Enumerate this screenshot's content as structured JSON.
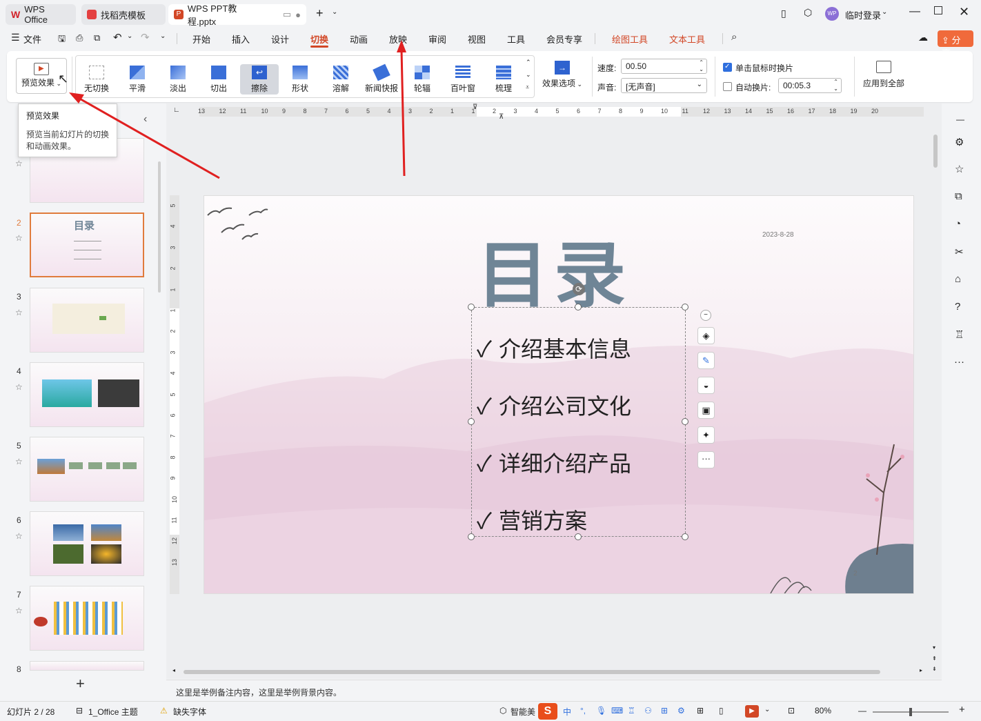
{
  "tabs": [
    {
      "label": "WPS Office"
    },
    {
      "label": "找稻壳模板"
    },
    {
      "label": "WPS PPT教程.pptx"
    }
  ],
  "titlebar": {
    "user": "临时登录",
    "avatar": "WP"
  },
  "menu": {
    "file": "文件",
    "items": [
      "开始",
      "插入",
      "设计",
      "切换",
      "动画",
      "放映",
      "审阅",
      "视图",
      "工具",
      "会员专享",
      "绘图工具",
      "文本工具"
    ],
    "share": "分享"
  },
  "ribbon": {
    "preview": "预览效果",
    "transitions": [
      "无切换",
      "平滑",
      "淡出",
      "切出",
      "擦除",
      "形状",
      "溶解",
      "新闻快报",
      "轮辐",
      "百叶窗",
      "梳理"
    ],
    "effect_options": "效果选项",
    "speed_label": "速度:",
    "speed_value": "00.50",
    "sound_label": "声音:",
    "sound_value": "[无声音]",
    "on_click_label": "单击鼠标时换片",
    "auto_label": "自动换片:",
    "auto_value": "00:05.3",
    "apply_all": "应用到全部"
  },
  "tooltip": {
    "title": "预览效果",
    "line1": "预览当前幻灯片的切换",
    "line2": "和动画效果。"
  },
  "slides": {
    "numbers": [
      "2",
      "3",
      "4",
      "5",
      "6",
      "7",
      "8"
    ]
  },
  "slide": {
    "title": "目录",
    "date": "2023-8-28",
    "bullets": [
      "介绍基本信息",
      "介绍公司文化",
      "详细介绍产品",
      "营销方案"
    ],
    "page": "2"
  },
  "notes": "这里是举例备注内容，这里是举例背景内容。",
  "status": {
    "slide_count": "幻灯片 2 / 28",
    "theme": "1_Office 主题",
    "missing_font": "缺失字体",
    "smart": "智能美",
    "zoom": "80%"
  },
  "ruler_h": [
    "13",
    "12",
    "11",
    "10",
    "9",
    "8",
    "7",
    "6",
    "5",
    "4",
    "3",
    "2",
    "1",
    "1",
    "2",
    "3",
    "4",
    "5",
    "6",
    "7",
    "8",
    "9",
    "10",
    "11",
    "12",
    "13",
    "14",
    "15",
    "16",
    "17",
    "18",
    "19",
    "20"
  ],
  "ruler_v": [
    "5",
    "4",
    "3",
    "2",
    "1",
    "1",
    "2",
    "3",
    "4",
    "5",
    "6",
    "7",
    "8",
    "9",
    "10",
    "11",
    "12",
    "13"
  ],
  "colors": {
    "accent": "#d24726",
    "selection": "#e07b3c",
    "checkbox": "#2f6fde",
    "title": "#6f8596"
  }
}
